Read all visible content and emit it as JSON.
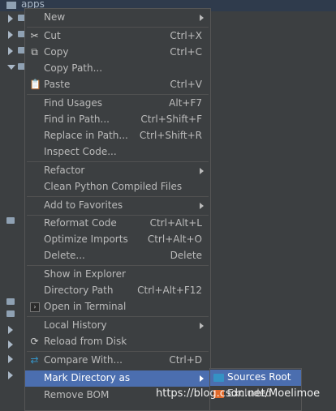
{
  "tree": {
    "top_label": "apps"
  },
  "menu": {
    "items": [
      {
        "label": "New",
        "shortcut": "",
        "submenu": true
      },
      {
        "label": "Cut",
        "shortcut": "Ctrl+X",
        "icon": "cut-icon"
      },
      {
        "label": "Copy",
        "shortcut": "Ctrl+C",
        "icon": "copy-icon"
      },
      {
        "label": "Copy Path...",
        "shortcut": ""
      },
      {
        "label": "Paste",
        "shortcut": "Ctrl+V",
        "icon": "paste-icon"
      },
      {
        "label": "Find Usages",
        "shortcut": "Alt+F7"
      },
      {
        "label": "Find in Path...",
        "shortcut": "Ctrl+Shift+F"
      },
      {
        "label": "Replace in Path...",
        "shortcut": "Ctrl+Shift+R"
      },
      {
        "label": "Inspect Code...",
        "shortcut": ""
      },
      {
        "label": "Refactor",
        "shortcut": "",
        "submenu": true
      },
      {
        "label": "Clean Python Compiled Files",
        "shortcut": ""
      },
      {
        "label": "Add to Favorites",
        "shortcut": "",
        "submenu": true
      },
      {
        "label": "Reformat Code",
        "shortcut": "Ctrl+Alt+L"
      },
      {
        "label": "Optimize Imports",
        "shortcut": "Ctrl+Alt+O"
      },
      {
        "label": "Delete...",
        "shortcut": "Delete"
      },
      {
        "label": "Show in Explorer",
        "shortcut": ""
      },
      {
        "label": "Directory Path",
        "shortcut": "Ctrl+Alt+F12"
      },
      {
        "label": "Open in Terminal",
        "shortcut": "",
        "icon": "terminal-icon"
      },
      {
        "label": "Local History",
        "shortcut": "",
        "submenu": true
      },
      {
        "label": "Reload from Disk",
        "shortcut": "",
        "icon": "reload-icon"
      },
      {
        "label": "Compare With...",
        "shortcut": "Ctrl+D",
        "icon": "compare-icon"
      },
      {
        "label": "Mark Directory as",
        "shortcut": "",
        "submenu": true,
        "selected": true
      },
      {
        "label": "Remove BOM",
        "shortcut": ""
      }
    ]
  },
  "submenu": {
    "items": [
      {
        "label": "Sources Root",
        "color": "#3592c4",
        "selected": true
      },
      {
        "label": "Excluded",
        "color": "#e06a2c"
      }
    ]
  },
  "watermark": "https://blog.csdn.net/Moelimoe",
  "colors": {
    "menu_bg": "#3c3f41",
    "selection": "#4b6eaf",
    "text": "#bbbbbb"
  }
}
